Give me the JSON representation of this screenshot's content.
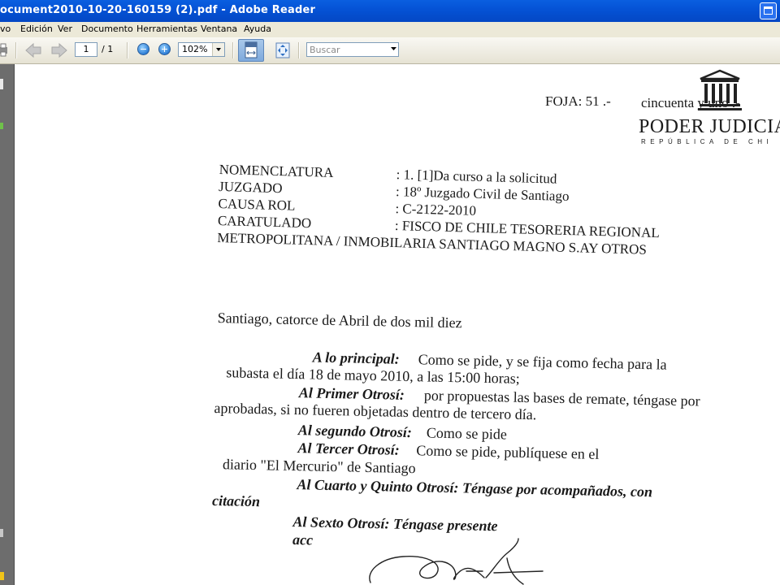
{
  "window": {
    "title": "ocument2010-10-20-160159 (2).pdf - Adobe Reader"
  },
  "menu": [
    "vo",
    "Edición",
    "Ver",
    "Documento",
    "Herramientas",
    "Ventana",
    "Ayuda"
  ],
  "toolbar": {
    "page_current": "1",
    "page_total": "/ 1",
    "zoom": "102%",
    "search_placeholder": "Buscar"
  },
  "document": {
    "foja": "FOJA: 51 .-",
    "foja_words": "cincuenta y uno .-",
    "seal_title": "PODER JUDICIA",
    "seal_subtitle": "REPÚBLICA DE CHI",
    "fields": [
      {
        "label": "NOMENCLATURA",
        "value": ": 1. [1]Da curso a la solicitud"
      },
      {
        "label": "JUZGADO",
        "value": ": 18º Juzgado Civil de Santiago"
      },
      {
        "label": "CAUSA ROL",
        "value": ": C-2122-2010"
      },
      {
        "label": "CARATULADO",
        "value": ": FISCO DE CHILE TESORERIA REGIONAL"
      }
    ],
    "caratulado_cont": "METROPOLITANA / INMOBILARIA SANTIAGO MAGNO S.AY OTROS",
    "date_line": "Santiago,  catorce  de Abril de dos mil diez",
    "p1_head": "A lo principal:",
    "p1_text": " Como se pide, y se fija como fecha para la",
    "p1_line2": "subasta el día 18 de mayo 2010, a las 15:00 horas;",
    "p2_head": "Al Primer Otrosí:",
    "p2_text": " por propuestas las bases de remate, téngase por",
    "p2_line2": "aprobadas, si no fueren objetadas dentro de tercero día.",
    "p3_head": "Al segundo  Otrosí:",
    "p3_text": " Como se pide",
    "p4_head": "Al Tercer  Otrosí:",
    "p4_text": " Como se pide, publíquese en el",
    "p4_line2": "diario \"El Mercurio\" de Santiago",
    "p5_line1": "Al Cuarto  y Quinto Otrosí: Téngase por acompañados, con",
    "p5_line2": "citación",
    "p6_line1": "Al Sexto Otrosí: Téngase presente",
    "p6_line2": "acc"
  }
}
